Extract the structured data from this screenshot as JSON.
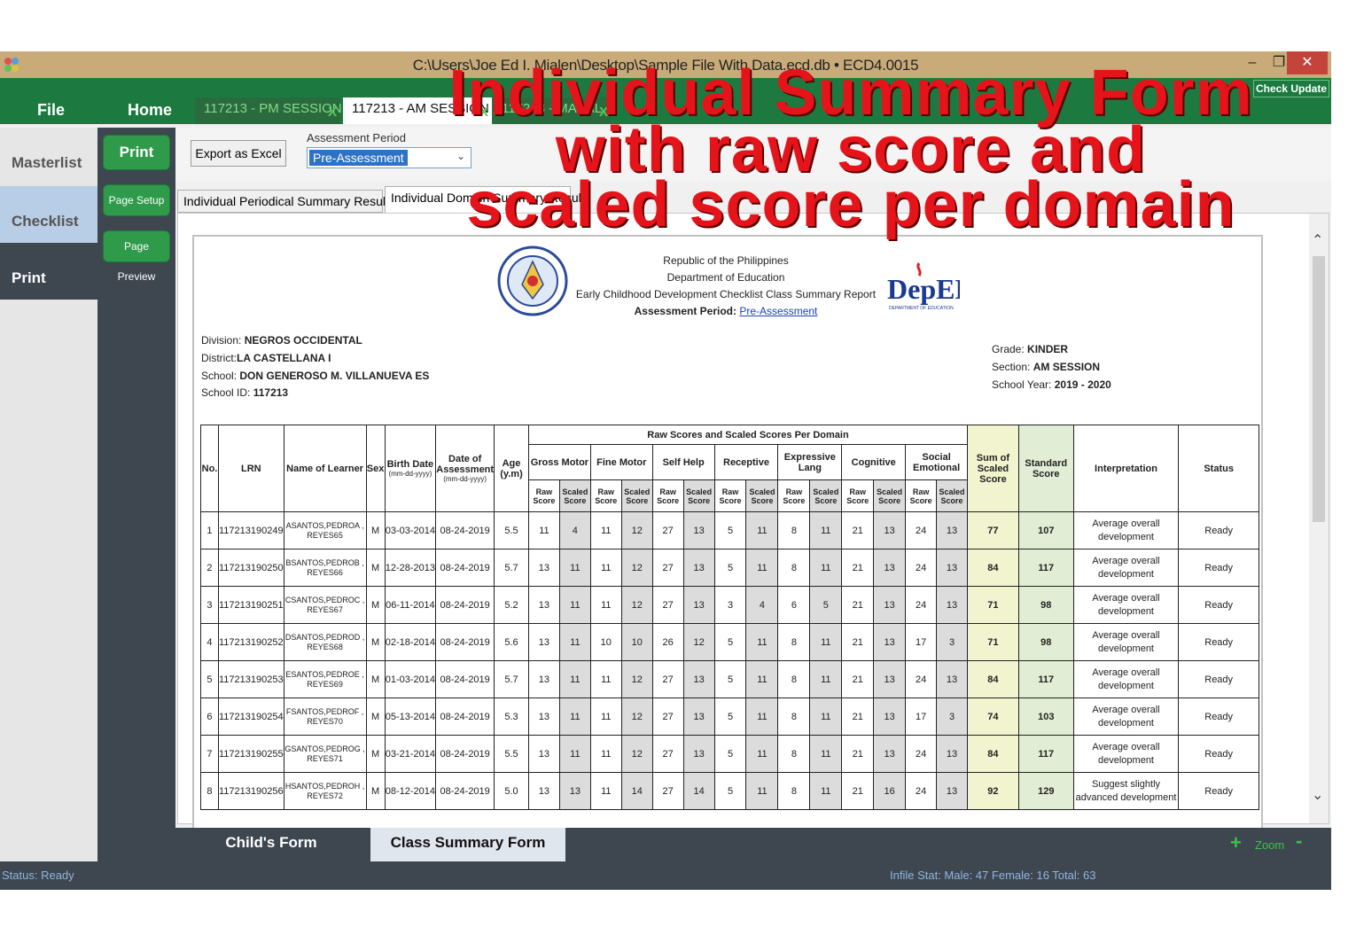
{
  "window": {
    "title": "C:\\Users\\Joe Ed I. Mialen\\Desktop\\Sample File With Data.ecd.db  •  ECD4.0015",
    "check_update": "Check Update"
  },
  "menu": {
    "file": "File",
    "home": "Home"
  },
  "session_tabs": [
    {
      "label": "117213 -  PM SESSION",
      "close": "X"
    },
    {
      "label": "117213 -  AM SESSION",
      "close": "X"
    },
    {
      "label": "117213 - MABAL",
      "close": "X"
    }
  ],
  "leftnav": {
    "masterlist": "Masterlist",
    "checklist": "Checklist",
    "print": "Print"
  },
  "print_panel": {
    "print": "Print",
    "page_setup": "Page Setup",
    "page_preview": "Page Preview"
  },
  "toolbar": {
    "export": "Export as Excel",
    "assessment_label": "Assessment Period",
    "assessment_value": "Pre-Assessment"
  },
  "subtabs": {
    "periodical": "Individual Periodical Summary Results",
    "domain": "Individual Domain Summary Results"
  },
  "report": {
    "line1": "Republic of the Philippines",
    "line2": "Department of Education",
    "line3": "Early Childhood Development Checklist Class Summary Report",
    "period_label": "Assessment Period:",
    "period_value": "Pre-Assessment",
    "deped_logo": "DepED",
    "deped_sub": "DEPARTMENT OF EDUCATION",
    "division_label": "Division:",
    "division": "NEGROS OCCIDENTAL",
    "district_label": "District:",
    "district": "LA CASTELLANA I",
    "school_label": "School:",
    "school": "DON GENEROSO M. VILLANUEVA ES",
    "school_id_label": "School ID:",
    "school_id": "117213",
    "grade_label": "Grade:",
    "grade": "KINDER",
    "section_label": "Section:",
    "section": "AM SESSION",
    "sy_label": "School Year:",
    "sy": "2019 - 2020"
  },
  "table": {
    "group_header": "Raw Scores and Scaled Scores Per Domain",
    "col_no": "No.",
    "col_lrn": "LRN",
    "col_name": "Name of Learner",
    "col_sex": "Sex",
    "col_birth": "Birth Date",
    "col_birth_fmt": "(mm-dd-yyyy)",
    "col_doa": "Date of Assessment",
    "col_doa_fmt": "(mm-dd-yyyy)",
    "col_age": "Age (y.m)",
    "domains": [
      "Gross Motor",
      "Fine Motor",
      "Self Help",
      "Receptive",
      "Expressive Lang",
      "Cognitive",
      "Social Emotional"
    ],
    "raw_label": "Raw Score",
    "scaled_label": "Scaled Score",
    "col_sum": "Sum of Scaled Score",
    "col_std": "Standard Score",
    "col_interp": "Interpretation",
    "col_status": "Status",
    "rows": [
      {
        "no": "1",
        "lrn": "117213190249",
        "name": "ASANTOS,PEDROA , REYES65",
        "sex": "M",
        "birth": "03-03-2014",
        "doa": "08-24-2019",
        "age": "5.5",
        "scores": [
          "11",
          "4",
          "11",
          "12",
          "27",
          "13",
          "5",
          "11",
          "8",
          "11",
          "21",
          "13",
          "24",
          "13"
        ],
        "sum": "77",
        "std": "107",
        "interp": "Average overall development",
        "status": "Ready"
      },
      {
        "no": "2",
        "lrn": "117213190250",
        "name": "BSANTOS,PEDROB , REYES66",
        "sex": "M",
        "birth": "12-28-2013",
        "doa": "08-24-2019",
        "age": "5.7",
        "scores": [
          "13",
          "11",
          "11",
          "12",
          "27",
          "13",
          "5",
          "11",
          "8",
          "11",
          "21",
          "13",
          "24",
          "13"
        ],
        "sum": "84",
        "std": "117",
        "interp": "Average overall development",
        "status": "Ready"
      },
      {
        "no": "3",
        "lrn": "117213190251",
        "name": "CSANTOS,PEDROC , REYES67",
        "sex": "M",
        "birth": "06-11-2014",
        "doa": "08-24-2019",
        "age": "5.2",
        "scores": [
          "13",
          "11",
          "11",
          "12",
          "27",
          "13",
          "3",
          "4",
          "6",
          "5",
          "21",
          "13",
          "24",
          "13"
        ],
        "sum": "71",
        "std": "98",
        "interp": "Average overall development",
        "status": "Ready"
      },
      {
        "no": "4",
        "lrn": "117213190252",
        "name": "DSANTOS,PEDROD , REYES68",
        "sex": "M",
        "birth": "02-18-2014",
        "doa": "08-24-2019",
        "age": "5.6",
        "scores": [
          "13",
          "11",
          "10",
          "10",
          "26",
          "12",
          "5",
          "11",
          "8",
          "11",
          "21",
          "13",
          "17",
          "3"
        ],
        "sum": "71",
        "std": "98",
        "interp": "Average overall development",
        "status": "Ready"
      },
      {
        "no": "5",
        "lrn": "117213190253",
        "name": "ESANTOS,PEDROE , REYES69",
        "sex": "M",
        "birth": "01-03-2014",
        "doa": "08-24-2019",
        "age": "5.7",
        "scores": [
          "13",
          "11",
          "11",
          "12",
          "27",
          "13",
          "5",
          "11",
          "8",
          "11",
          "21",
          "13",
          "24",
          "13"
        ],
        "sum": "84",
        "std": "117",
        "interp": "Average overall development",
        "status": "Ready"
      },
      {
        "no": "6",
        "lrn": "117213190254",
        "name": "FSANTOS,PEDROF , REYES70",
        "sex": "M",
        "birth": "05-13-2014",
        "doa": "08-24-2019",
        "age": "5.3",
        "scores": [
          "13",
          "11",
          "11",
          "12",
          "27",
          "13",
          "5",
          "11",
          "8",
          "11",
          "21",
          "13",
          "17",
          "3"
        ],
        "sum": "74",
        "std": "103",
        "interp": "Average overall development",
        "status": "Ready"
      },
      {
        "no": "7",
        "lrn": "117213190255",
        "name": "GSANTOS,PEDROG , REYES71",
        "sex": "M",
        "birth": "03-21-2014",
        "doa": "08-24-2019",
        "age": "5.5",
        "scores": [
          "13",
          "11",
          "11",
          "12",
          "27",
          "13",
          "5",
          "11",
          "8",
          "11",
          "21",
          "13",
          "24",
          "13"
        ],
        "sum": "84",
        "std": "117",
        "interp": "Average overall development",
        "status": "Ready"
      },
      {
        "no": "8",
        "lrn": "117213190256",
        "name": "HSANTOS,PEDROH , REYES72",
        "sex": "M",
        "birth": "08-12-2014",
        "doa": "08-24-2019",
        "age": "5.0",
        "scores": [
          "13",
          "13",
          "11",
          "14",
          "27",
          "14",
          "5",
          "11",
          "8",
          "11",
          "21",
          "16",
          "24",
          "13"
        ],
        "sum": "92",
        "std": "129",
        "interp": "Suggest slightly advanced development",
        "status": "Ready"
      }
    ]
  },
  "bottom_tabs": {
    "child": "Child's Form",
    "class": "Class Summary Form",
    "zoom_plus": "+",
    "zoom": "Zoom",
    "zoom_minus": "-"
  },
  "status": {
    "left": "Status: Ready",
    "right": "Infile Stat:  Male: 47  Female: 16   Total: 63"
  },
  "overlay": {
    "line1": "Individual Summary Form",
    "line2": "with raw score and",
    "line3": "scaled score per domain"
  }
}
